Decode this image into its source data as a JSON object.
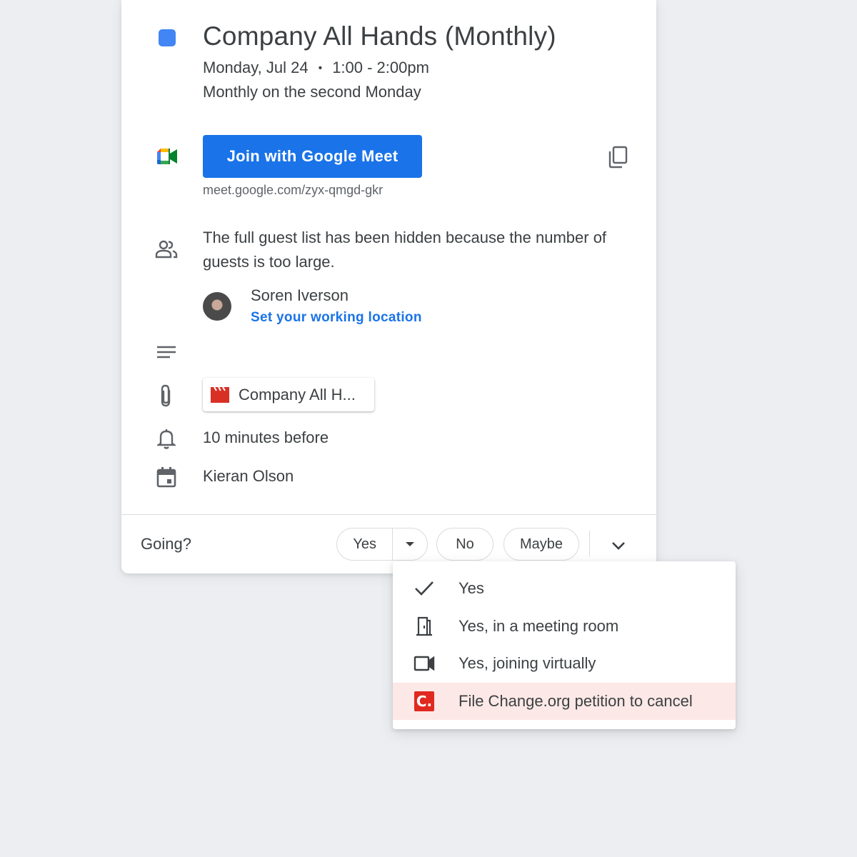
{
  "colors": {
    "event": "#4285f4",
    "meet_button": "#1a73e8",
    "change_org": "#e0291f",
    "clapper": "#d93025",
    "menu_highlight": "#fce8e6"
  },
  "event": {
    "title": "Company All Hands (Monthly)",
    "date": "Monday, Jul 24",
    "time": "1:00 - 2:00pm",
    "recurrence": "Monthly on the second Monday"
  },
  "meet": {
    "button_label": "Join with Google Meet",
    "url": "meet.google.com/zyx-qmgd-gkr",
    "icon": "google-meet-icon",
    "copy_icon": "copy-icon"
  },
  "guests": {
    "notice": "The full guest list has been hidden because the number of guests is too large.",
    "person_name": "Soren Iverson",
    "person_link": "Set your working location"
  },
  "attachment": {
    "label": "Company All H..."
  },
  "reminder": "10 minutes before",
  "organizer": "Kieran Olson",
  "rsvp": {
    "prompt": "Going?",
    "yes": "Yes",
    "no": "No",
    "maybe": "Maybe"
  },
  "menu": {
    "items": [
      {
        "label": "Yes",
        "icon": "checkmark-icon"
      },
      {
        "label": "Yes, in a meeting room",
        "icon": "door-icon"
      },
      {
        "label": "Yes, joining virtually",
        "icon": "video-camera-icon"
      },
      {
        "label": "File Change.org petition to cancel",
        "icon": "change-org-logo",
        "logo_text": "C."
      }
    ]
  }
}
